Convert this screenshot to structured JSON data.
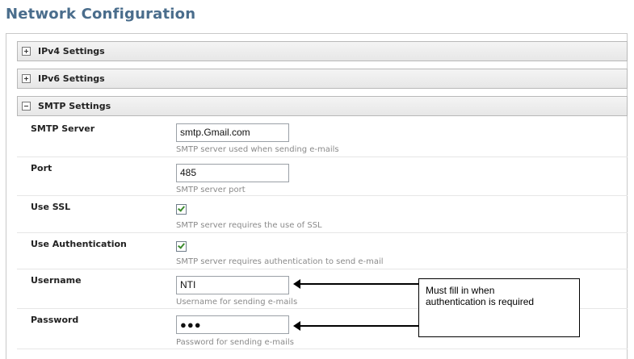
{
  "page": {
    "title": "Network Configuration"
  },
  "sections": [
    {
      "label": "IPv4 Settings",
      "expanded": false
    },
    {
      "label": "IPv6 Settings",
      "expanded": false
    },
    {
      "label": "SMTP Settings",
      "expanded": true
    }
  ],
  "smtp": {
    "server": {
      "label": "SMTP Server",
      "value": "smtp.Gmail.com",
      "description": "SMTP server used when sending e-mails"
    },
    "port": {
      "label": "Port",
      "value": "485",
      "description": "SMTP server port"
    },
    "use_ssl": {
      "label": "Use SSL",
      "checked": true,
      "description": "SMTP server requires the use of SSL"
    },
    "use_auth": {
      "label": "Use Authentication",
      "checked": true,
      "description": "SMTP server requires authentication to send e-mail"
    },
    "username": {
      "label": "Username",
      "value": "NTI",
      "description": "Username for sending e-mails"
    },
    "password": {
      "label": "Password",
      "value": "●●●",
      "description": "Password for sending e-mails"
    }
  },
  "annotation": {
    "line1": "Must fill in when",
    "line2": "authentication is required"
  },
  "colors": {
    "title": "#4a6d8c",
    "checkmark": "#3c8b2e",
    "description": "#8a8a8a"
  }
}
